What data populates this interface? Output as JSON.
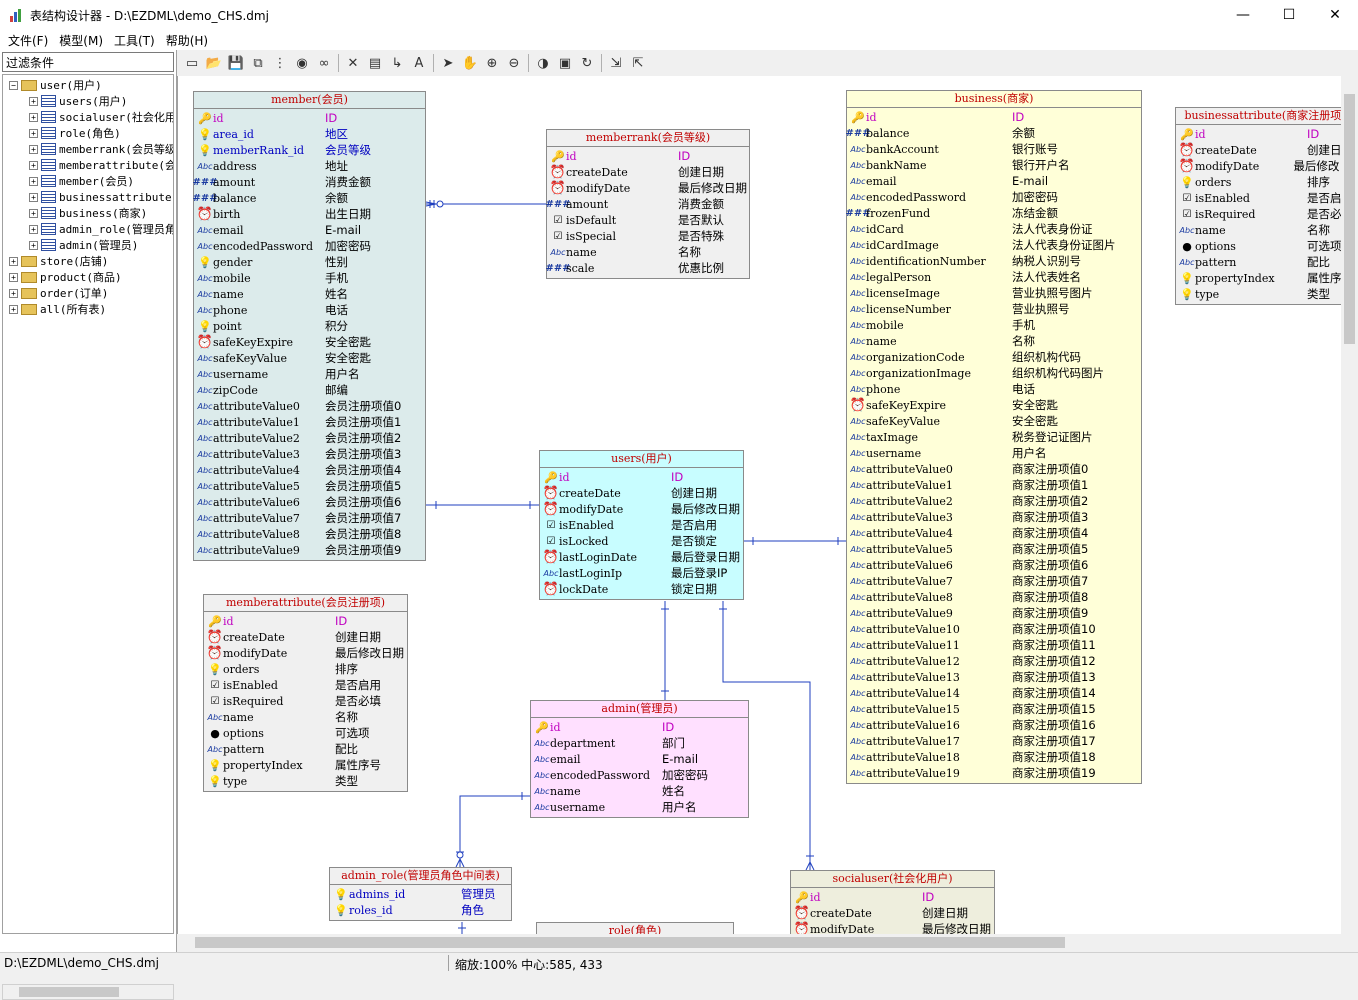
{
  "window": {
    "title": "表结构设计器 - D:\\EZDML\\demo_CHS.dmj",
    "min_glyph": "—",
    "max_glyph": "☐",
    "close_glyph": "✕"
  },
  "menu": [
    "文件(F)",
    "模型(M)",
    "工具(T)",
    "帮助(H)"
  ],
  "filter_label": "过滤条件",
  "tree": [
    {
      "label": "user(用户)",
      "level": 0,
      "expanded": true,
      "kind": "folder"
    },
    {
      "label": "users(用户)",
      "level": 1,
      "kind": "table"
    },
    {
      "label": "socialuser(社会化用",
      "level": 1,
      "kind": "table"
    },
    {
      "label": "role(角色)",
      "level": 1,
      "kind": "table"
    },
    {
      "label": "memberrank(会员等级",
      "level": 1,
      "kind": "table"
    },
    {
      "label": "memberattribute(会",
      "level": 1,
      "kind": "table"
    },
    {
      "label": "member(会员)",
      "level": 1,
      "kind": "table"
    },
    {
      "label": "businessattribute(",
      "level": 1,
      "kind": "table"
    },
    {
      "label": "business(商家)",
      "level": 1,
      "kind": "table"
    },
    {
      "label": "admin_role(管理员角",
      "level": 1,
      "kind": "table"
    },
    {
      "label": "admin(管理员)",
      "level": 1,
      "kind": "table"
    },
    {
      "label": "store(店铺)",
      "level": 0,
      "expanded": false,
      "kind": "folder"
    },
    {
      "label": "product(商品)",
      "level": 0,
      "expanded": false,
      "kind": "folder"
    },
    {
      "label": "order(订单)",
      "level": 0,
      "expanded": false,
      "kind": "folder"
    },
    {
      "label": "all(所有表)",
      "level": 0,
      "expanded": false,
      "kind": "folder"
    }
  ],
  "toolbar_icons": [
    "new-icon",
    "open-icon",
    "save-icon",
    "save-as-icon",
    "tree-icon",
    "globe-icon",
    "binoculars-icon",
    "sep",
    "delete-icon",
    "table-icon",
    "link-icon",
    "text-icon",
    "sep",
    "pointer-icon",
    "hand-icon",
    "zoom-in-icon",
    "zoom-out-icon",
    "sep",
    "eye-icon",
    "image-icon",
    "refresh-icon",
    "sep",
    "import-icon",
    "export-icon"
  ],
  "entities": {
    "member": {
      "title": "member(会员)",
      "bg": "#dcebeb",
      "fields": [
        [
          "id",
          "ID",
          "key",
          "pk"
        ],
        [
          "area_id",
          "地区",
          "bulb",
          "fk"
        ],
        [
          "memberRank_id",
          "会员等级",
          "bulb",
          "fk"
        ],
        [
          "address",
          "地址",
          "str",
          ""
        ],
        [
          "amount",
          "消费金额",
          "num",
          ""
        ],
        [
          "balance",
          "余额",
          "num",
          ""
        ],
        [
          "birth",
          "出生日期",
          "dt",
          ""
        ],
        [
          "email",
          "E-mail",
          "str",
          ""
        ],
        [
          "encodedPassword",
          "加密密码",
          "str",
          ""
        ],
        [
          "gender",
          "性别",
          "bulb",
          ""
        ],
        [
          "mobile",
          "手机",
          "str",
          ""
        ],
        [
          "name",
          "姓名",
          "str",
          ""
        ],
        [
          "phone",
          "电话",
          "str",
          ""
        ],
        [
          "point",
          "积分",
          "bulb",
          ""
        ],
        [
          "safeKeyExpire",
          "安全密匙",
          "dt",
          ""
        ],
        [
          "safeKeyValue",
          "安全密匙",
          "str",
          ""
        ],
        [
          "username",
          "用户名",
          "str",
          ""
        ],
        [
          "zipCode",
          "邮编",
          "str",
          ""
        ],
        [
          "attributeValue0",
          "会员注册项值0",
          "str",
          ""
        ],
        [
          "attributeValue1",
          "会员注册项值1",
          "str",
          ""
        ],
        [
          "attributeValue2",
          "会员注册项值2",
          "str",
          ""
        ],
        [
          "attributeValue3",
          "会员注册项值3",
          "str",
          ""
        ],
        [
          "attributeValue4",
          "会员注册项值4",
          "str",
          ""
        ],
        [
          "attributeValue5",
          "会员注册项值5",
          "str",
          ""
        ],
        [
          "attributeValue6",
          "会员注册项值6",
          "str",
          ""
        ],
        [
          "attributeValue7",
          "会员注册项值7",
          "str",
          ""
        ],
        [
          "attributeValue8",
          "会员注册项值8",
          "str",
          ""
        ],
        [
          "attributeValue9",
          "会员注册项值9",
          "str",
          ""
        ]
      ]
    },
    "memberrank": {
      "title": "memberrank(会员等级)",
      "bg": "#f0f0f0",
      "fields": [
        [
          "id",
          "ID",
          "key",
          "pk"
        ],
        [
          "createDate",
          "创建日期",
          "dt",
          ""
        ],
        [
          "modifyDate",
          "最后修改日期",
          "dt",
          ""
        ],
        [
          "amount",
          "消费金额",
          "num",
          ""
        ],
        [
          "isDefault",
          "是否默认",
          "chk",
          ""
        ],
        [
          "isSpecial",
          "是否特殊",
          "chk",
          ""
        ],
        [
          "name",
          "名称",
          "str",
          ""
        ],
        [
          "scale",
          "优惠比例",
          "num",
          ""
        ]
      ]
    },
    "users": {
      "title": "users(用户)",
      "bg": "#c8fdff",
      "fields": [
        [
          "id",
          "ID",
          "key",
          "pk"
        ],
        [
          "createDate",
          "创建日期",
          "dt",
          ""
        ],
        [
          "modifyDate",
          "最后修改日期",
          "dt",
          ""
        ],
        [
          "isEnabled",
          "是否启用",
          "chk",
          ""
        ],
        [
          "isLocked",
          "是否锁定",
          "chk",
          ""
        ],
        [
          "lastLoginDate",
          "最后登录日期",
          "dt",
          ""
        ],
        [
          "lastLoginIp",
          "最后登录IP",
          "str",
          ""
        ],
        [
          "lockDate",
          "锁定日期",
          "dt",
          ""
        ]
      ]
    },
    "memberattribute": {
      "title": "memberattribute(会员注册项)",
      "bg": "#f0f0f0",
      "fields": [
        [
          "id",
          "ID",
          "key",
          "pk"
        ],
        [
          "createDate",
          "创建日期",
          "dt",
          ""
        ],
        [
          "modifyDate",
          "最后修改日期",
          "dt",
          ""
        ],
        [
          "orders",
          "排序",
          "bulb",
          ""
        ],
        [
          "isEnabled",
          "是否启用",
          "chk",
          ""
        ],
        [
          "isRequired",
          "是否必填",
          "chk",
          ""
        ],
        [
          "name",
          "名称",
          "str",
          ""
        ],
        [
          "options",
          "可选项",
          "obj",
          ""
        ],
        [
          "pattern",
          "配比",
          "str",
          ""
        ],
        [
          "propertyIndex",
          "属性序号",
          "bulb",
          ""
        ],
        [
          "type",
          "类型",
          "bulb",
          ""
        ]
      ]
    },
    "admin": {
      "title": "admin(管理员)",
      "bg": "#ffe0ff",
      "fields": [
        [
          "id",
          "ID",
          "key",
          "pk"
        ],
        [
          "department",
          "部门",
          "str",
          ""
        ],
        [
          "email",
          "E-mail",
          "str",
          ""
        ],
        [
          "encodedPassword",
          "加密密码",
          "str",
          ""
        ],
        [
          "name",
          "姓名",
          "str",
          ""
        ],
        [
          "username",
          "用户名",
          "str",
          ""
        ]
      ]
    },
    "admin_role": {
      "title": "admin_role(管理员角色中间表)",
      "bg": "#f0f0f0",
      "fields": [
        [
          "admins_id",
          "管理员",
          "bulb",
          "fk"
        ],
        [
          "roles_id",
          "角色",
          "bulb",
          "fk"
        ]
      ]
    },
    "role": {
      "title": "role(角色)",
      "bg": "#f0f0f0",
      "fields": []
    },
    "socialuser": {
      "title": "socialuser(社会化用户)",
      "bg": "#eeeedd",
      "fields": [
        [
          "id",
          "ID",
          "key",
          "pk"
        ],
        [
          "createDate",
          "创建日期",
          "dt",
          ""
        ],
        [
          "modifyDate",
          "最后修改日期",
          "dt",
          ""
        ]
      ]
    },
    "business": {
      "title": "business(商家)",
      "bg": "#ffffd8",
      "fields": [
        [
          "id",
          "ID",
          "key",
          "pk"
        ],
        [
          "balance",
          "余额",
          "num",
          ""
        ],
        [
          "bankAccount",
          "银行账号",
          "str",
          ""
        ],
        [
          "bankName",
          "银行开户名",
          "str",
          ""
        ],
        [
          "email",
          "E-mail",
          "str",
          ""
        ],
        [
          "encodedPassword",
          "加密密码",
          "str",
          ""
        ],
        [
          "frozenFund",
          "冻结金额",
          "num",
          ""
        ],
        [
          "idCard",
          "法人代表身份证",
          "str",
          ""
        ],
        [
          "idCardImage",
          "法人代表身份证图片",
          "str",
          ""
        ],
        [
          "identificationNumber",
          "纳税人识别号",
          "str",
          ""
        ],
        [
          "legalPerson",
          "法人代表姓名",
          "str",
          ""
        ],
        [
          "licenseImage",
          "营业执照号图片",
          "str",
          ""
        ],
        [
          "licenseNumber",
          "营业执照号",
          "str",
          ""
        ],
        [
          "mobile",
          "手机",
          "str",
          ""
        ],
        [
          "name",
          "名称",
          "str",
          ""
        ],
        [
          "organizationCode",
          "组织机构代码",
          "str",
          ""
        ],
        [
          "organizationImage",
          "组织机构代码图片",
          "str",
          ""
        ],
        [
          "phone",
          "电话",
          "str",
          ""
        ],
        [
          "safeKeyExpire",
          "安全密匙",
          "dt",
          ""
        ],
        [
          "safeKeyValue",
          "安全密匙",
          "str",
          ""
        ],
        [
          "taxImage",
          "税务登记证图片",
          "str",
          ""
        ],
        [
          "username",
          "用户名",
          "str",
          ""
        ],
        [
          "attributeValue0",
          "商家注册项值0",
          "str",
          ""
        ],
        [
          "attributeValue1",
          "商家注册项值1",
          "str",
          ""
        ],
        [
          "attributeValue2",
          "商家注册项值2",
          "str",
          ""
        ],
        [
          "attributeValue3",
          "商家注册项值3",
          "str",
          ""
        ],
        [
          "attributeValue4",
          "商家注册项值4",
          "str",
          ""
        ],
        [
          "attributeValue5",
          "商家注册项值5",
          "str",
          ""
        ],
        [
          "attributeValue6",
          "商家注册项值6",
          "str",
          ""
        ],
        [
          "attributeValue7",
          "商家注册项值7",
          "str",
          ""
        ],
        [
          "attributeValue8",
          "商家注册项值8",
          "str",
          ""
        ],
        [
          "attributeValue9",
          "商家注册项值9",
          "str",
          ""
        ],
        [
          "attributeValue10",
          "商家注册项值10",
          "str",
          ""
        ],
        [
          "attributeValue11",
          "商家注册项值11",
          "str",
          ""
        ],
        [
          "attributeValue12",
          "商家注册项值12",
          "str",
          ""
        ],
        [
          "attributeValue13",
          "商家注册项值13",
          "str",
          ""
        ],
        [
          "attributeValue14",
          "商家注册项值14",
          "str",
          ""
        ],
        [
          "attributeValue15",
          "商家注册项值15",
          "str",
          ""
        ],
        [
          "attributeValue16",
          "商家注册项值16",
          "str",
          ""
        ],
        [
          "attributeValue17",
          "商家注册项值17",
          "str",
          ""
        ],
        [
          "attributeValue18",
          "商家注册项值18",
          "str",
          ""
        ],
        [
          "attributeValue19",
          "商家注册项值19",
          "str",
          ""
        ]
      ]
    },
    "businessattribute": {
      "title": "businessattribute(商家注册项)",
      "bg": "#f0f0f0",
      "fields": [
        [
          "id",
          "ID",
          "key",
          "pk"
        ],
        [
          "createDate",
          "创建日期",
          "dt",
          ""
        ],
        [
          "modifyDate",
          "最后修改日期",
          "dt",
          ""
        ],
        [
          "orders",
          "排序",
          "bulb",
          ""
        ],
        [
          "isEnabled",
          "是否启用",
          "chk",
          ""
        ],
        [
          "isRequired",
          "是否必填",
          "chk",
          ""
        ],
        [
          "name",
          "名称",
          "str",
          ""
        ],
        [
          "options",
          "可选项",
          "obj",
          ""
        ],
        [
          "pattern",
          "配比",
          "str",
          ""
        ],
        [
          "propertyIndex",
          "属性序号",
          "bulb",
          ""
        ],
        [
          "type",
          "类型",
          "bulb",
          ""
        ]
      ]
    }
  },
  "status": {
    "file": "D:\\EZDML\\demo_CHS.dmj",
    "zoom": "缩放:100% 中心:585, 433"
  }
}
